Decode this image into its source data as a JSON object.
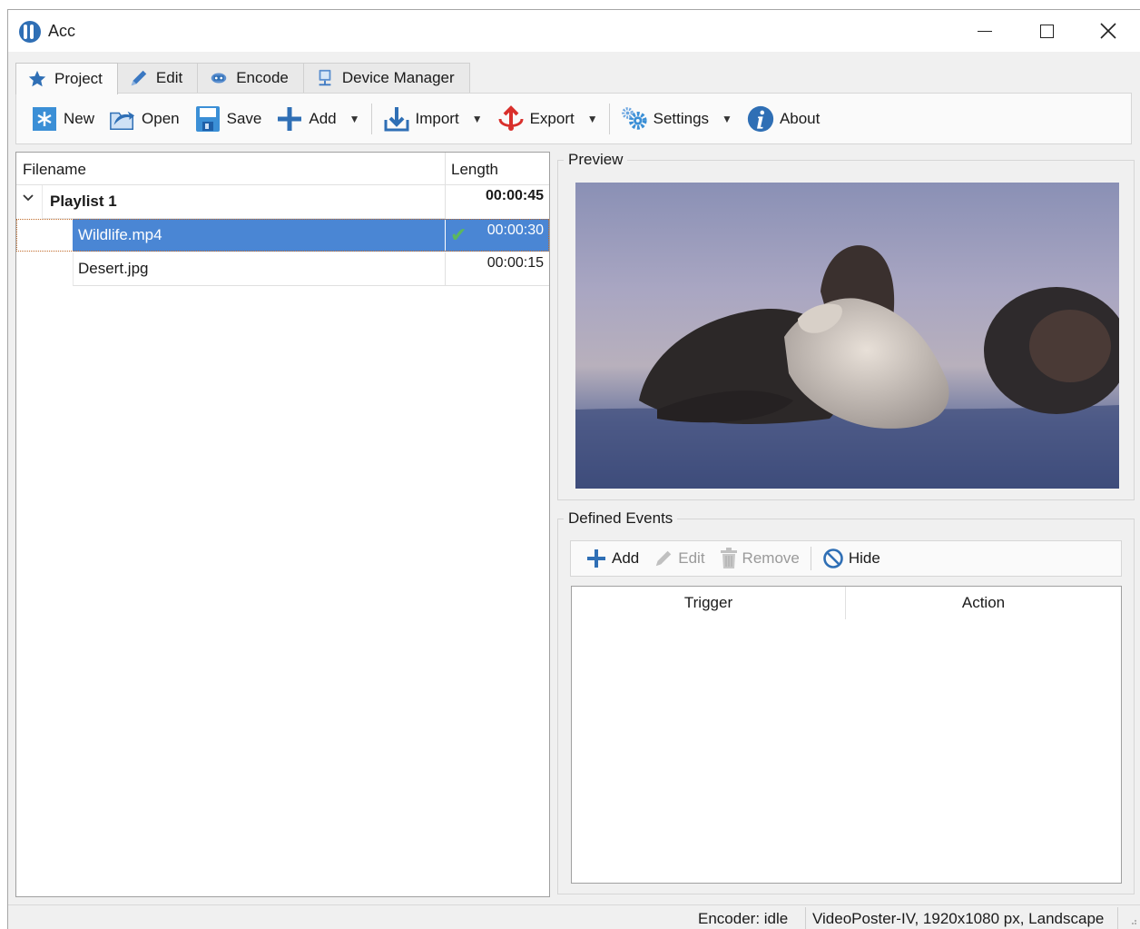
{
  "app": {
    "title": "Acc"
  },
  "tabs": [
    {
      "label": "Project",
      "icon": "star-icon"
    },
    {
      "label": "Edit",
      "icon": "pencil-icon"
    },
    {
      "label": "Encode",
      "icon": "encode-icon"
    },
    {
      "label": "Device Manager",
      "icon": "device-icon"
    }
  ],
  "toolbar": {
    "new": "New",
    "open": "Open",
    "save": "Save",
    "add": "Add",
    "import": "Import",
    "export": "Export",
    "settings": "Settings",
    "about": "About"
  },
  "file_list": {
    "col_filename": "Filename",
    "col_length": "Length",
    "playlist": {
      "name": "Playlist 1",
      "length": "00:00:45"
    },
    "items": [
      {
        "name": "Wildlife.mp4",
        "length": "00:00:30",
        "selected": true
      },
      {
        "name": "Desert.jpg",
        "length": "00:00:15",
        "selected": false
      }
    ]
  },
  "preview": {
    "label": "Preview"
  },
  "events": {
    "label": "Defined Events",
    "add": "Add",
    "edit": "Edit",
    "remove": "Remove",
    "hide": "Hide",
    "col_trigger": "Trigger",
    "col_action": "Action"
  },
  "status": {
    "encoder": "Encoder: idle",
    "device": "VideoPoster-IV, 1920x1080 px, Landscape"
  },
  "colors": {
    "selection": "#4a86d4",
    "accent": "#2f6fb5"
  }
}
